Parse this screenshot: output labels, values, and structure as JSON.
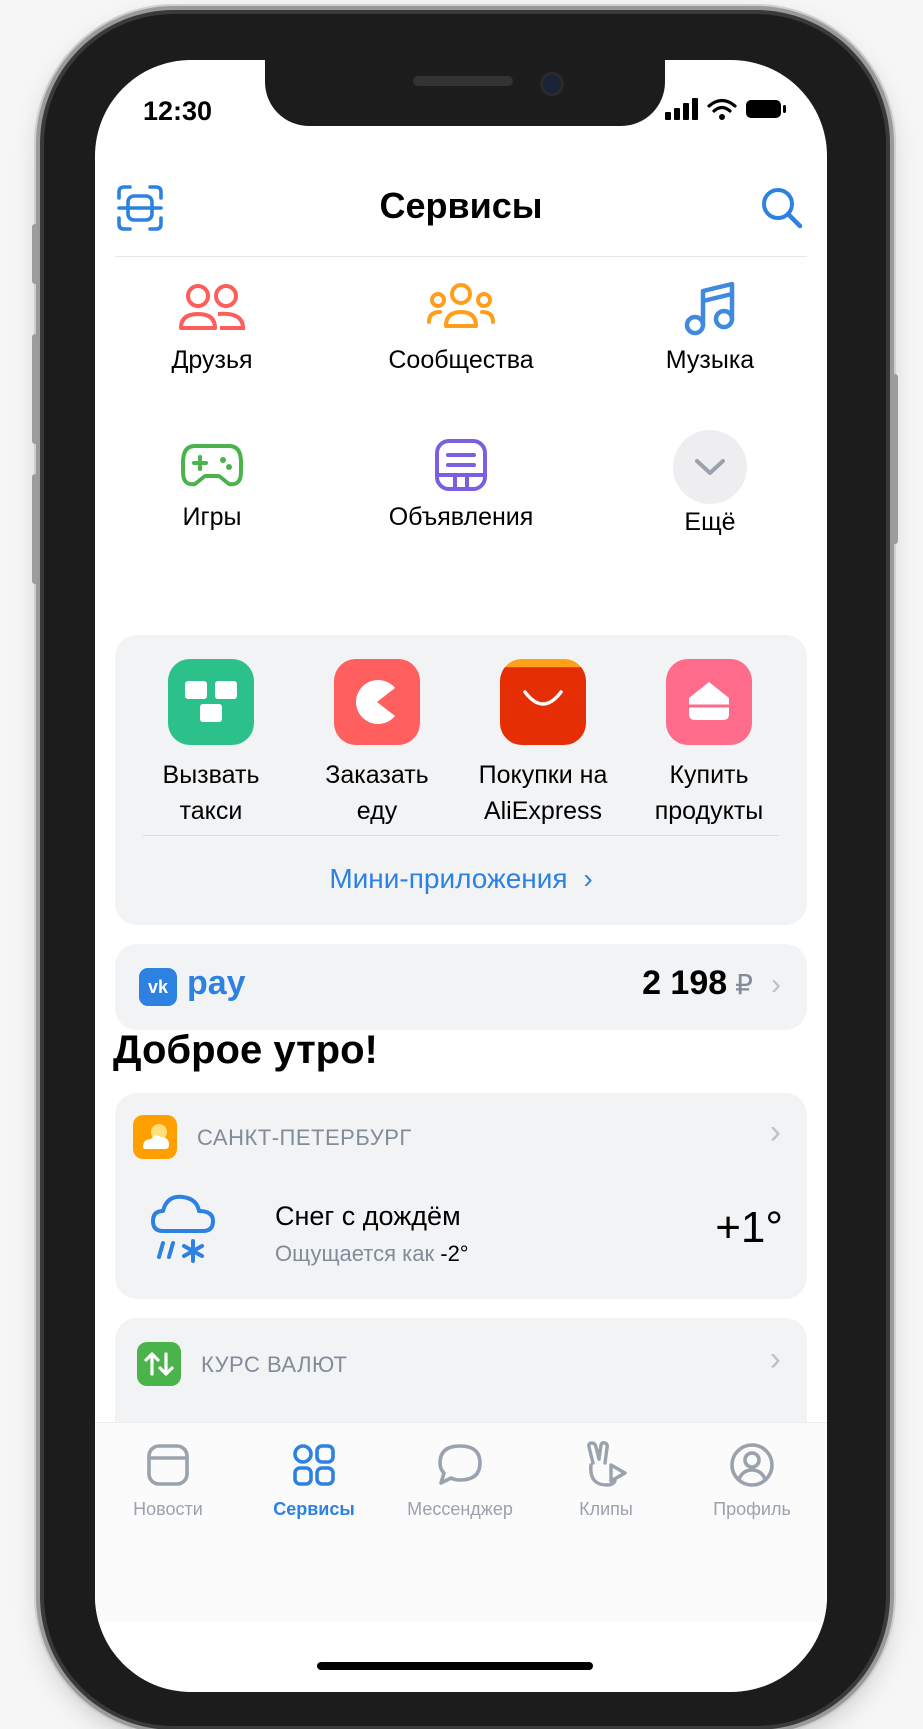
{
  "status_bar": {
    "time": "12:30"
  },
  "header": {
    "title": "Сервисы"
  },
  "services": [
    {
      "label": "Друзья",
      "icon": "friends-icon",
      "color": "#ff5c5c"
    },
    {
      "label": "Сообщества",
      "icon": "communities-icon",
      "color": "#ff9e1b"
    },
    {
      "label": "Музыка",
      "icon": "music-icon",
      "color": "#3f8ae0"
    },
    {
      "label": "Игры",
      "icon": "games-icon",
      "color": "#4bb34b"
    },
    {
      "label": "Объявления",
      "icon": "classifieds-icon",
      "color": "#7a5fe0"
    },
    {
      "label": "Ещё",
      "icon": "chevron-down-icon",
      "color": "#99a2ad"
    }
  ],
  "mini_apps": {
    "items": [
      {
        "label": "Вызвать\nтакси",
        "icon": "taxi-icon",
        "color": "#2cc18a"
      },
      {
        "label": "Заказать\nеду",
        "icon": "food-icon",
        "color": "#ff5f5f"
      },
      {
        "label": "Покупки на\nAliExpress",
        "icon": "aliexpress-icon",
        "color": "#e62e04"
      },
      {
        "label": "Купить\nпродукты",
        "icon": "groceries-icon",
        "color": "#ff6b8a"
      }
    ],
    "link_label": "Мини-приложения",
    "link_chevron": "›"
  },
  "vkpay": {
    "brand": "pay",
    "logo": "vk-logo-icon",
    "amount": "2 198",
    "currency": "₽",
    "chevron": "›"
  },
  "greeting": "Доброе утро!",
  "weather": {
    "city": "САНКТ-ПЕТЕРБУРГ",
    "condition": "Снег с дождём",
    "feels_like_label": "Ощущается как ",
    "feels_like_value": "-2°",
    "temperature": "+1°",
    "chevron": "›"
  },
  "currency": {
    "title": "КУРС ВАЛЮТ",
    "chevron": "›"
  },
  "tabs": [
    {
      "label": "Новости",
      "icon": "news-icon",
      "active": false
    },
    {
      "label": "Сервисы",
      "icon": "services-icon",
      "active": true
    },
    {
      "label": "Мессенджер",
      "icon": "messenger-icon",
      "active": false
    },
    {
      "label": "Клипы",
      "icon": "clips-icon",
      "active": false
    },
    {
      "label": "Профиль",
      "icon": "profile-icon",
      "active": false
    }
  ],
  "colors": {
    "accent": "#2d81e0",
    "card_bg": "#f2f3f5",
    "secondary_text": "#818c99"
  }
}
